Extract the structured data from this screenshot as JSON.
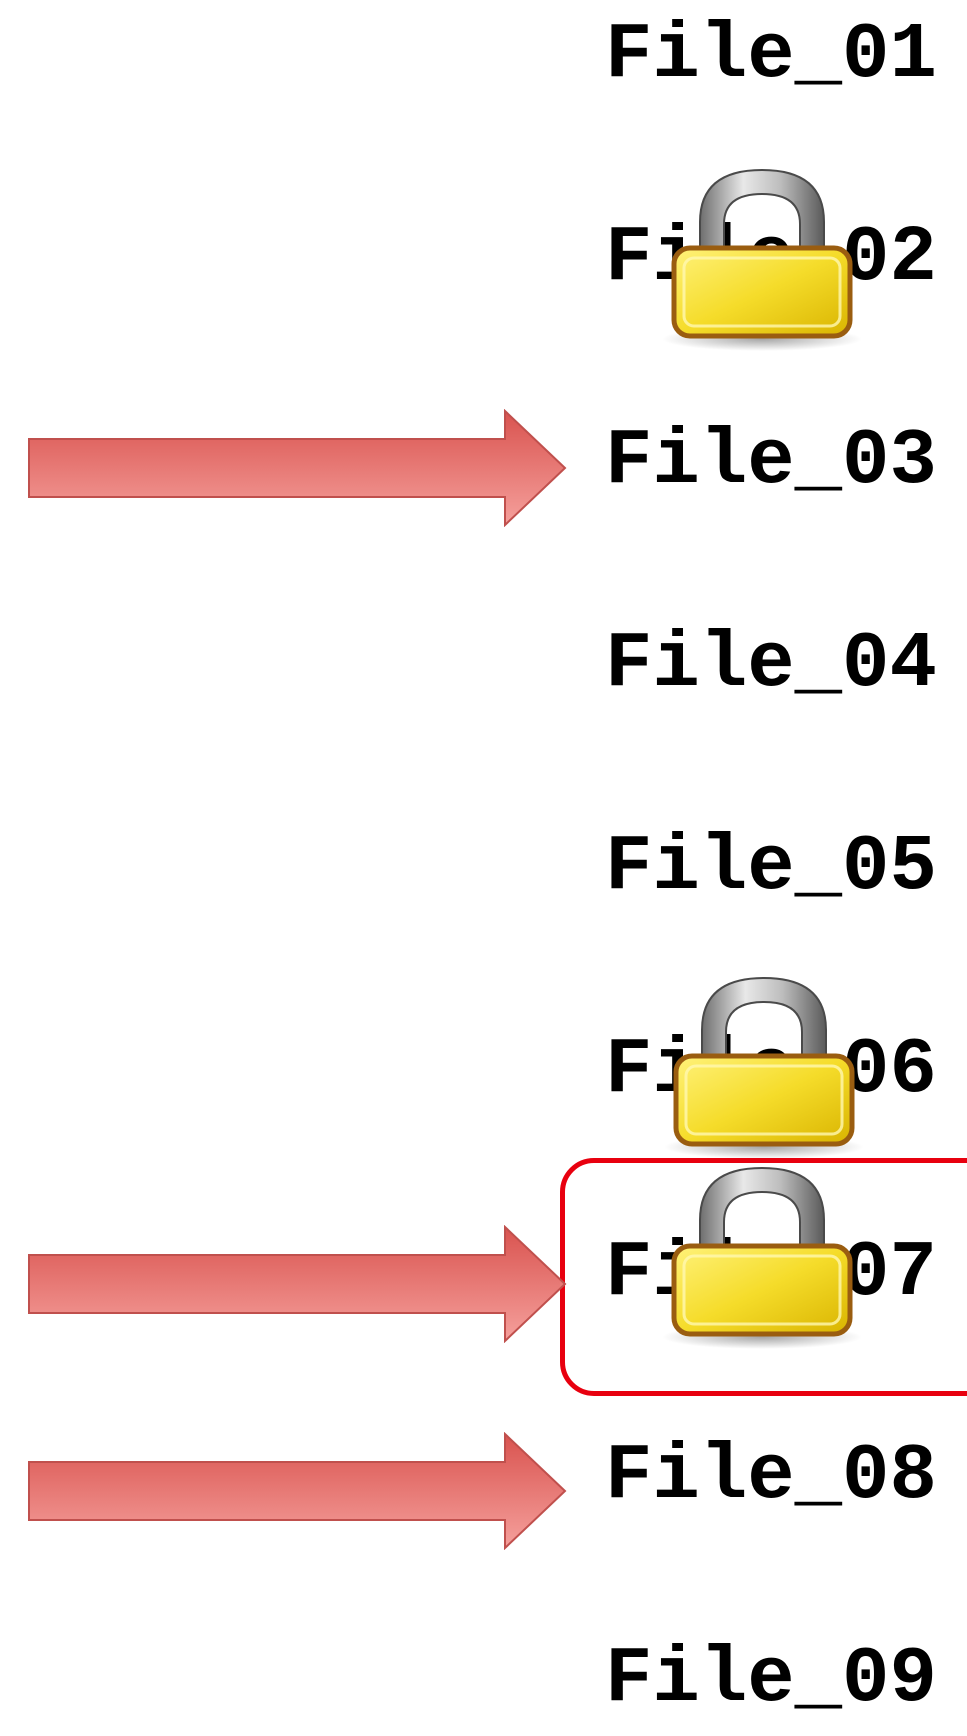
{
  "files": [
    {
      "label": "File_01",
      "locked": false,
      "arrow": false,
      "highlighted": false
    },
    {
      "label": "File_02",
      "locked": true,
      "arrow": false,
      "highlighted": false
    },
    {
      "label": "File_03",
      "locked": false,
      "arrow": true,
      "highlighted": false
    },
    {
      "label": "File_04",
      "locked": false,
      "arrow": false,
      "highlighted": false
    },
    {
      "label": "File_05",
      "locked": false,
      "arrow": false,
      "highlighted": false
    },
    {
      "label": "File_06",
      "locked": true,
      "arrow": false,
      "highlighted": false
    },
    {
      "label": "File_07",
      "locked": true,
      "arrow": true,
      "highlighted": true
    },
    {
      "label": "File_08",
      "locked": false,
      "arrow": true,
      "highlighted": false
    },
    {
      "label": "File_09",
      "locked": false,
      "arrow": false,
      "highlighted": false
    }
  ],
  "colors": {
    "arrow_fill_top": "#d9534f",
    "arrow_fill_bottom": "#f5a09c",
    "arrow_stroke": "#c0504d",
    "highlight_border": "#e8000f",
    "lock_body": "#f5dc2a",
    "lock_body_edge": "#9a5d10",
    "lock_shackle": "#9a9a9a"
  },
  "icons": {
    "lock": "padlock-icon",
    "arrow": "right-arrow-icon"
  }
}
